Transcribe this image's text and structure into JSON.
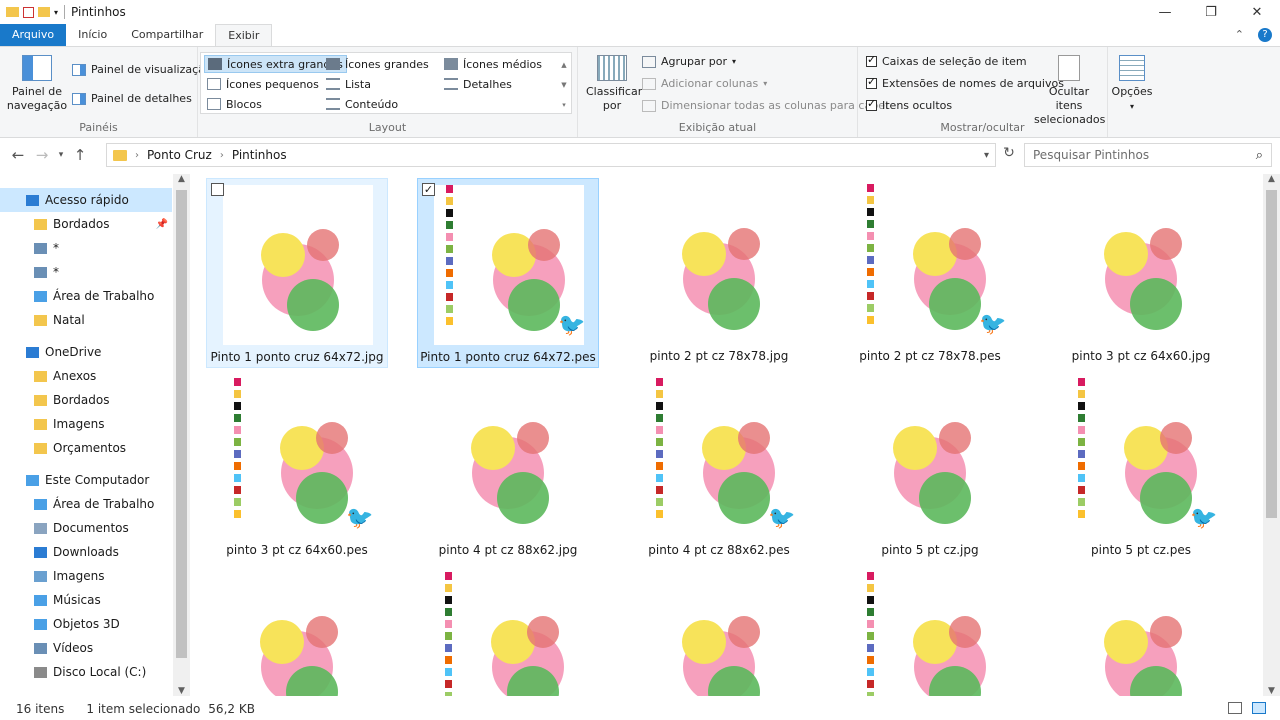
{
  "window": {
    "title": "Pintinhos",
    "controls": {
      "minimize": "—",
      "maximize": "❐",
      "close": "✕"
    }
  },
  "ribbon_tabs": {
    "file": "Arquivo",
    "home": "Início",
    "share": "Compartilhar",
    "view": "Exibir"
  },
  "ribbon": {
    "paineis": {
      "label": "Painéis",
      "nav_pane": "Painel de navegação",
      "preview_pane": "Painel de visualização",
      "details_pane": "Painel de detalhes"
    },
    "layout": {
      "label": "Layout",
      "items": [
        {
          "label": "Ícones extra grandes"
        },
        {
          "label": "Ícones grandes"
        },
        {
          "label": "Ícones médios"
        },
        {
          "label": "Ícones pequenos"
        },
        {
          "label": "Lista"
        },
        {
          "label": "Detalhes"
        },
        {
          "label": "Blocos"
        },
        {
          "label": "Conteúdo"
        }
      ]
    },
    "current_view": {
      "label": "Exibição atual",
      "sort": "Classificar por",
      "group_by": "Agrupar por",
      "add_columns": "Adicionar colunas",
      "size_columns": "Dimensionar todas as colunas para caber"
    },
    "show_hide": {
      "label": "Mostrar/ocultar",
      "item_checkboxes": "Caixas de seleção de item",
      "file_extensions": "Extensões de nomes de arquivos",
      "hidden_items": "Itens ocultos",
      "hide_selected": "Ocultar itens selecionados",
      "options": "Opções"
    }
  },
  "address": {
    "crumbs": [
      "Ponto Cruz",
      "Pintinhos"
    ],
    "search_placeholder": "Pesquisar Pintinhos"
  },
  "sidebar": {
    "items": [
      {
        "label": "Acesso rápido",
        "icon": "star-icon",
        "color": "#2b7cd3"
      },
      {
        "label": "Bordados",
        "icon": "folder-icon",
        "color": "#f3c64d"
      },
      {
        "label": "*",
        "icon": "search-icon",
        "color": "#6a8fb5"
      },
      {
        "label": "*",
        "icon": "search-icon",
        "color": "#6a8fb5"
      },
      {
        "label": "Área de Trabalho",
        "icon": "desktop-icon",
        "color": "#4aa0e6"
      },
      {
        "label": "Natal",
        "icon": "folder-icon",
        "color": "#f3c64d"
      },
      {
        "label": "OneDrive",
        "icon": "cloud-icon",
        "color": "#2b7cd3"
      },
      {
        "label": "Anexos",
        "icon": "folder-icon",
        "color": "#f3c64d"
      },
      {
        "label": "Bordados",
        "icon": "folder-icon",
        "color": "#f3c64d"
      },
      {
        "label": "Imagens",
        "icon": "folder-icon",
        "color": "#f3c64d"
      },
      {
        "label": "Orçamentos",
        "icon": "folder-icon",
        "color": "#f3c64d"
      },
      {
        "label": "Este Computador",
        "icon": "computer-icon",
        "color": "#4aa0e6"
      },
      {
        "label": "Área de Trabalho",
        "icon": "desktop-icon",
        "color": "#4aa0e6"
      },
      {
        "label": "Documentos",
        "icon": "documents-icon",
        "color": "#8aa4c0"
      },
      {
        "label": "Downloads",
        "icon": "downloads-icon",
        "color": "#2b7cd3"
      },
      {
        "label": "Imagens",
        "icon": "pictures-icon",
        "color": "#6aa0d0"
      },
      {
        "label": "Músicas",
        "icon": "music-icon",
        "color": "#4aa0e6"
      },
      {
        "label": "Objetos 3D",
        "icon": "cube-icon",
        "color": "#4aa0e6"
      },
      {
        "label": "Vídeos",
        "icon": "video-icon",
        "color": "#6a8fb5"
      },
      {
        "label": "Disco Local (C:)",
        "icon": "drive-icon",
        "color": "#8a8a8a"
      }
    ]
  },
  "files": [
    {
      "name": "Pinto 1 ponto cruz 64x72.jpg",
      "kind": "jpg",
      "state": "hover"
    },
    {
      "name": "Pinto 1 ponto cruz 64x72.pes",
      "kind": "pes",
      "state": "selected"
    },
    {
      "name": "pinto 2 pt cz 78x78.jpg",
      "kind": "jpg",
      "state": ""
    },
    {
      "name": "pinto 2 pt cz 78x78.pes",
      "kind": "pes",
      "state": ""
    },
    {
      "name": "pinto 3 pt cz 64x60.jpg",
      "kind": "jpg",
      "state": ""
    },
    {
      "name": "pinto 3 pt cz 64x60.pes",
      "kind": "pes",
      "state": ""
    },
    {
      "name": "pinto 4 pt cz 88x62.jpg",
      "kind": "jpg",
      "state": ""
    },
    {
      "name": "pinto 4 pt cz 88x62.pes",
      "kind": "pes",
      "state": ""
    },
    {
      "name": "pinto 5 pt cz.jpg",
      "kind": "jpg",
      "state": ""
    },
    {
      "name": "pinto 5 pt cz.pes",
      "kind": "pes",
      "state": ""
    },
    {
      "name": "",
      "kind": "jpg",
      "state": ""
    },
    {
      "name": "",
      "kind": "pes",
      "state": ""
    },
    {
      "name": "",
      "kind": "jpg",
      "state": ""
    },
    {
      "name": "",
      "kind": "pes",
      "state": ""
    },
    {
      "name": "",
      "kind": "jpg",
      "state": ""
    }
  ],
  "status": {
    "count": "16 itens",
    "selection": "1 item selecionado",
    "size": "56,2 KB"
  },
  "colors": {
    "accent": "#1979ca",
    "selection": "#cce8ff",
    "folder": "#f3c64d"
  }
}
